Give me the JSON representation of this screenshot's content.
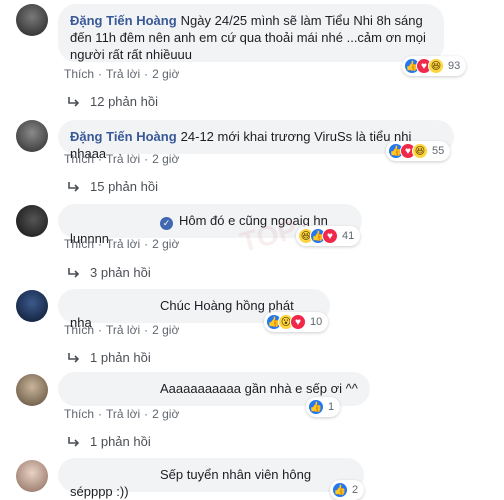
{
  "comments": [
    {
      "author": "Đặng Tiến Hoàng",
      "text": "Ngày 24/25 mình sẽ làm Tiểu Nhi 8h sáng đến 11h đêm nên anh em cứ qua thoải mái nhé ...cảm ơn mọi người rất rất nhiềuuu",
      "like": "Thích",
      "reply": "Trả lời",
      "time": "2 giờ",
      "reactions": [
        "like",
        "love",
        "haha"
      ],
      "reaction_count": "93",
      "replies": "12 phản hồi"
    },
    {
      "author": "Đặng Tiến Hoàng",
      "text": "24-12 mới khai trương ViruSs là tiểu nhị nhaaa",
      "like": "Thích",
      "reply": "Trả lời",
      "time": "2 giờ",
      "reactions": [
        "like",
        "love",
        "haha"
      ],
      "reaction_count": "55",
      "replies": "15 phản hồi"
    },
    {
      "author": "",
      "text": "Hôm đó e cũng ngoaig hn lunnnn",
      "like": "Thích",
      "reply": "Trả lời",
      "time": "2 giờ",
      "reactions": [
        "haha",
        "like",
        "love"
      ],
      "reaction_count": "41",
      "replies": "3 phản hồi"
    },
    {
      "author": "",
      "text": "Chúc Hoàng hồng phát nha",
      "like": "Thích",
      "reply": "Trả lời",
      "time": "2 giờ",
      "reactions": [
        "like",
        "wow",
        "love"
      ],
      "reaction_count": "10",
      "replies": "1 phản hồi"
    },
    {
      "author": "",
      "text": "Aaaaaaaaaaa gần nhà e sếp ơi ^^",
      "like": "Thích",
      "reply": "Trả lời",
      "time": "2 giờ",
      "reactions": [
        "like"
      ],
      "reaction_count": "1",
      "replies": "1 phản hồi"
    },
    {
      "author": "",
      "text": "Sếp tuyển nhân viên hông sépppp :))",
      "reactions": [
        "like"
      ],
      "reaction_count": "2"
    }
  ],
  "colors": {
    "link": "#385898",
    "bubble": "#f2f3f5",
    "meta": "#606770",
    "like": "#2078f4",
    "love": "#f0284a",
    "haha": "#fcd53f"
  }
}
